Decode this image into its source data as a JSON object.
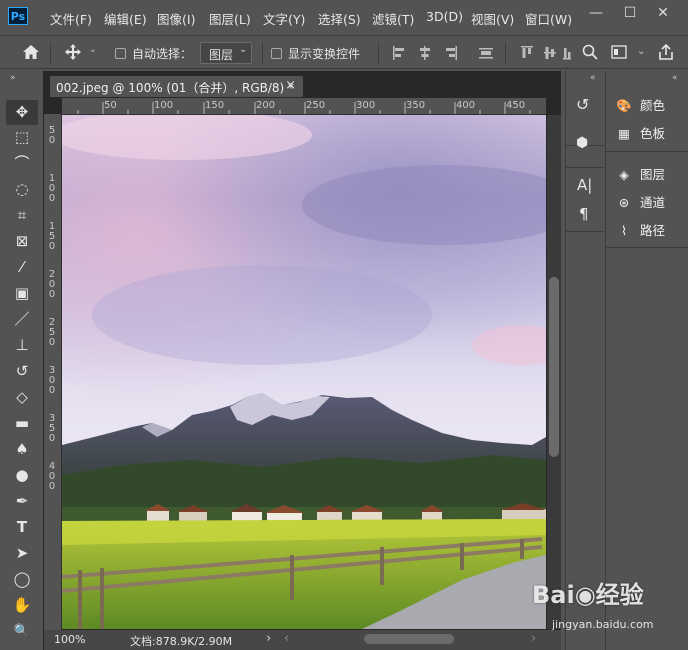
{
  "app": {
    "logo": "Ps",
    "name": "Adobe Photoshop"
  },
  "menu": [
    "文件(F)",
    "编辑(E)",
    "图像(I)",
    "图层(L)",
    "文字(Y)",
    "选择(S)",
    "滤镜(T)",
    "3D(D)",
    "视图(V)",
    "窗口(W)"
  ],
  "window_controls": {
    "minimize": "—",
    "maximize": "☐",
    "close": "✕"
  },
  "options_bar": {
    "auto_select_label": "自动选择：",
    "auto_select_checked": false,
    "target_value": "图层",
    "show_transform_label": "显示变换控件",
    "show_transform_checked": false
  },
  "document": {
    "tab_title": "002.jpeg @ 100% (01（合并）, RGB/8) *",
    "ruler_h": [
      "50",
      "100",
      "150",
      "200",
      "250",
      "300",
      "350",
      "400",
      "450"
    ],
    "ruler_v": [
      "5",
      "0",
      "1",
      "0",
      "0",
      "1",
      "5",
      "0",
      "2",
      "0",
      "0",
      "2",
      "5",
      "0",
      "3",
      "0",
      "0",
      "3",
      "5",
      "0",
      "4",
      "0",
      "0",
      "4",
      "5",
      "0"
    ],
    "zoom": "100%",
    "doc_info": "文档:878.9K/2.90M"
  },
  "tools": [
    "move-tool",
    "marquee-tool",
    "lasso-tool",
    "quick-select-tool",
    "crop-tool",
    "frame-tool",
    "eyedropper-tool",
    "healing-tool",
    "brush-tool",
    "stamp-tool",
    "history-brush-tool",
    "eraser-tool",
    "gradient-tool",
    "blur-tool",
    "dodge-tool",
    "pen-tool",
    "type-tool",
    "path-select-tool",
    "shape-tool",
    "hand-tool",
    "zoom-tool"
  ],
  "tool_glyphs": [
    "✥",
    "⬚",
    "⌒",
    "◌",
    "⌗",
    "⊠",
    "⁄",
    "▣",
    "／",
    "⊥",
    "↺",
    "◇",
    "▬",
    "♠",
    "●",
    "✒",
    "T",
    "➤",
    "◯",
    "✋",
    "🔍"
  ],
  "panels": [
    {
      "label": "颜色",
      "icon": "palette-icon",
      "glyph": "🎨"
    },
    {
      "label": "色板",
      "icon": "swatches-icon",
      "glyph": "▦"
    },
    {
      "label": "图层",
      "icon": "layers-icon",
      "glyph": "◈"
    },
    {
      "label": "通道",
      "icon": "channels-icon",
      "glyph": "⊛"
    },
    {
      "label": "路径",
      "icon": "paths-icon",
      "glyph": "⌇"
    }
  ],
  "dock_icons": [
    {
      "name": "history-icon",
      "glyph": "↺"
    },
    {
      "name": "3d-cube-icon",
      "glyph": "⬢"
    },
    {
      "name": "character-icon",
      "glyph": "A|"
    },
    {
      "name": "paragraph-icon",
      "glyph": "¶"
    }
  ],
  "watermark": {
    "brand": "Bai◉经验",
    "url": "jingyan.baidu.com"
  }
}
